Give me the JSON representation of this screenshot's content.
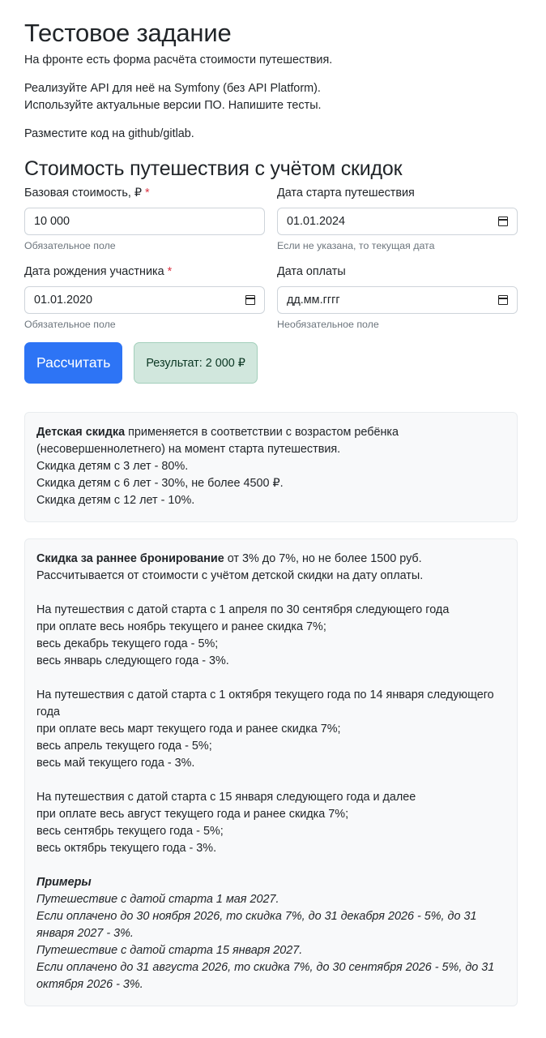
{
  "heading": "Тестовое задание",
  "intro": {
    "p1": "На фронте есть форма расчёта стоимости путешествия.",
    "p2a": "Реализуйте API для неё на Symfony (без API Platform).",
    "p2b": "Используйте актуальные версии ПО. Напишите тесты.",
    "p3": "Разместите код на github/gitlab."
  },
  "form": {
    "title": "Стоимость путешествия с учётом скидок",
    "base_cost": {
      "label": "Базовая стоимость, ₽",
      "required": "*",
      "value": "10 000",
      "help": "Обязательное поле"
    },
    "start_date": {
      "label": "Дата старта путешествия",
      "value": "01.01.2024",
      "help": "Если не указана, то текущая дата"
    },
    "birth_date": {
      "label": "Дата рождения участника",
      "required": "*",
      "value": "01.01.2020",
      "help": "Обязательное поле"
    },
    "pay_date": {
      "label": "Дата оплаты",
      "value": "дд.мм.гггг",
      "help": "Необязательное поле"
    },
    "submit_label": "Рассчитать",
    "result_text": "Результат: 2 000 ₽"
  },
  "colors": {
    "primary": "#2d74f5",
    "success_bg": "#d1e7dd",
    "required": "#dc3545"
  },
  "child_discount": {
    "title": "Детская скидка",
    "line1": "применяется в соответствии с возрастом ребёнка",
    "line2": "(несовершеннолетнего) на момент старта путешествия.",
    "line3": "Скидка детям с 3 лет - 80%.",
    "line4": "Скидка детям с 6 лет - 30%, не более 4500 ₽.",
    "line5": "Скидка детям с 12 лет - 10%."
  },
  "early_booking": {
    "title": "Скидка за раннее бронирование",
    "line1": "от 3% до 7%, но не более 1500 руб.",
    "line2": "Рассчитывается от стоимости с учётом детской скидки на дату оплаты.",
    "b1": [
      "На путешествия с датой старта с 1 апреля по 30 сентября следующего года",
      "при оплате весь ноябрь текущего и ранее скидка 7%;",
      "весь декабрь текущего года - 5%;",
      "весь январь следующего года - 3%."
    ],
    "b2": [
      "На путешествия с датой старта с 1 октября текущего года по 14 января следующего",
      "года",
      "при оплате весь март текущего года и ранее скидка 7%;",
      "весь апрель текущего года - 5%;",
      "весь май текущего года - 3%."
    ],
    "b3": [
      "На путешествия с датой старта с 15 января следующего года и далее",
      "при оплате весь август текущего года и ранее скидка 7%;",
      "весь сентябрь текущего года - 5%;",
      "весь октябрь текущего года - 3%."
    ],
    "examples_title": "Примеры",
    "examples": [
      "Путешествие с датой старта 1 мая 2027.",
      "Если оплачено до 30 ноября 2026, то скидка 7%, до 31 декабря 2026 - 5%, до 31",
      "января 2027 - 3%.",
      "Путешествие с датой старта 15 января 2027.",
      "Если оплачено до 31 августа 2026, то скидка 7%, до 30 сентября 2026 - 5%, до 31",
      "октября 2026 - 3%."
    ]
  }
}
